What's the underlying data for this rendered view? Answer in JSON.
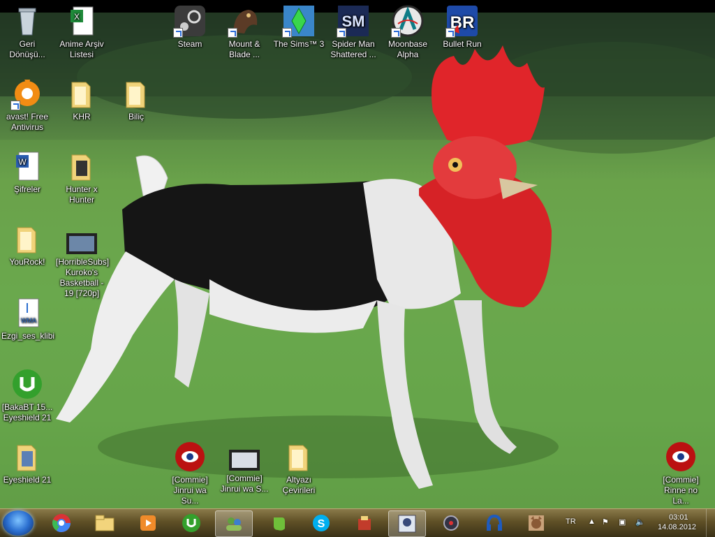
{
  "desktop_icons": {
    "recycle_bin": "Geri Dönüşü...",
    "anime_list": "Anime Arşiv Listesi",
    "steam": "Steam",
    "mount_blade": "Mount & Blade ...",
    "sims": "The Sims™ 3",
    "spiderman": "Spider Man Shattered ...",
    "moonbase": "Moonbase Alpha",
    "bulletrun": "Bullet Run",
    "avast": "avast! Free Antivirus",
    "khr": "KHR",
    "bilic": "Biliç",
    "sifreler": "Şifreler",
    "hunter": "Hunter x Hunter",
    "yourock": "YouRock!",
    "kuroko": "[HorribleSubs] Kuroko's Basketball - 19 [720p]",
    "ezgi": "Ezgi_ses_klibi",
    "bakabt": "[BakaBT 15... Eyeshield 21",
    "eyeshield": "Eyeshield 21",
    "commie1": "[Commie] Jinrui wa Su...",
    "commie2": "[Commie] Jinrui wa S...",
    "altyazi": "Altyazı Çevirileri",
    "commie3": "[Commie] Rinne no La..."
  },
  "taskbar": {
    "lang": "TR",
    "time": "03:01",
    "date": "14.08.2012"
  },
  "colors": {
    "grass": "#6aa24b",
    "taskbar": "#5f5026",
    "comb": "#e0252a"
  }
}
